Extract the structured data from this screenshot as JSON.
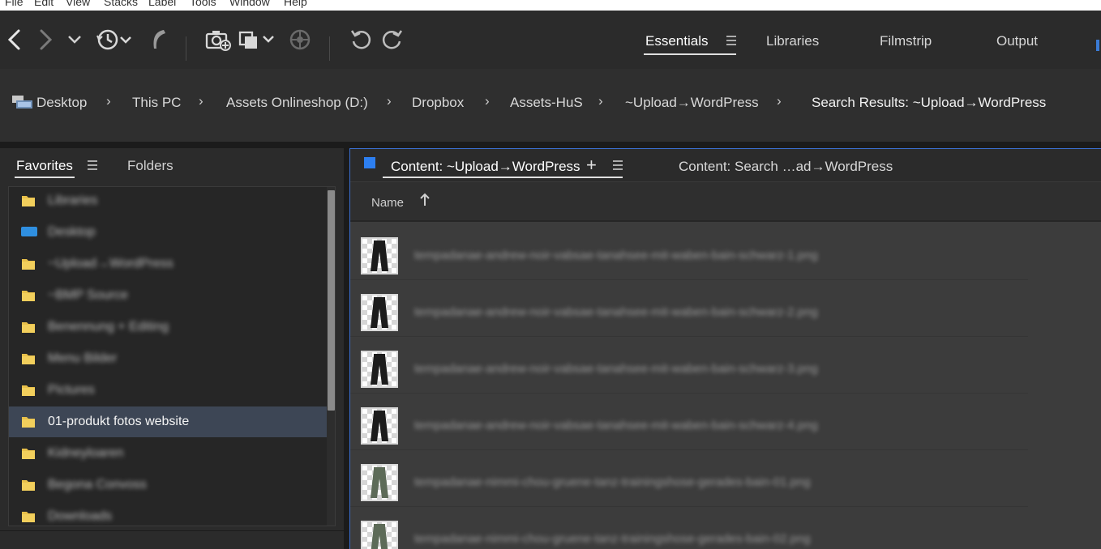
{
  "menubar": [
    "File",
    "Edit",
    "View",
    "Stacks",
    "Label",
    "Tools",
    "Window",
    "Help"
  ],
  "workspaces": {
    "tabs": [
      "Essentials",
      "Libraries",
      "Filmstrip",
      "Output"
    ],
    "active": "Essentials"
  },
  "breadcrumb": [
    {
      "label": "Desktop",
      "icon": "desktop-icon"
    },
    {
      "label": "This PC"
    },
    {
      "label": "Assets Onlineshop (D:)"
    },
    {
      "label": "Dropbox"
    },
    {
      "label": "Assets-HuS"
    },
    {
      "label": "~Upload→WordPress"
    },
    {
      "label": "Search Results: ~Upload→WordPress"
    }
  ],
  "left_panel": {
    "tabs": [
      "Favorites",
      "Folders"
    ],
    "active": "Favorites",
    "favorites": [
      {
        "label": "Libraries",
        "icon": "folder-icon",
        "blurred": true
      },
      {
        "label": "Desktop",
        "icon": "desktop-icon",
        "blurred": true
      },
      {
        "label": "~Upload→WordPress",
        "icon": "folder-icon",
        "blurred": true
      },
      {
        "label": "~BMP Source",
        "icon": "folder-icon",
        "blurred": true
      },
      {
        "label": "Benennung + Editing",
        "icon": "folder-icon",
        "blurred": true
      },
      {
        "label": "Menu Bilder",
        "icon": "folder-icon",
        "blurred": true
      },
      {
        "label": "Pictures",
        "icon": "folder-icon",
        "blurred": true
      },
      {
        "label": "01-produkt fotos website",
        "icon": "folder-icon",
        "blurred": false,
        "selected": true
      },
      {
        "label": "Kidneyloaren",
        "icon": "folder-icon",
        "blurred": true
      },
      {
        "label": "Begona Convoss",
        "icon": "folder-icon",
        "blurred": true
      },
      {
        "label": "Downloads",
        "icon": "folder-icon",
        "blurred": true
      }
    ]
  },
  "content": {
    "tabs": [
      "Content: ~Upload→WordPress",
      "Content: Search …ad→WordPress"
    ],
    "active": "Content: ~Upload→WordPress",
    "add_label": "+",
    "sort": {
      "label": "Name",
      "direction": "ascending"
    },
    "items": [
      {
        "name": "tempadanae-andrew-noir-vabsae-tanahsee-mit-waben-bain-schwarz-1.png",
        "thumb_color": "#1c1c1c"
      },
      {
        "name": "tempadanae-andrew-noir-vabsae-tanahsee-mit-waben-bain-schwarz-2.png",
        "thumb_color": "#1c1c1c"
      },
      {
        "name": "tempadanae-andrew-noir-vabsae-tanahsee-mit-waben-bain-schwarz-3.png",
        "thumb_color": "#1c1c1c"
      },
      {
        "name": "tempadanae-andrew-noir-vabsae-tanahsee-mit-waben-bain-schwarz-4.png",
        "thumb_color": "#1c1c1c"
      },
      {
        "name": "tempadanae-nimmi-chou-gruene-tanz-trainingshose-gerades-bain-01.png",
        "thumb_color": "#5d6b58"
      },
      {
        "name": "tempadanae-nimmi-chou-gruene-tanz-trainingshose-gerades-bain-02.png",
        "thumb_color": "#5d6b58"
      }
    ]
  }
}
